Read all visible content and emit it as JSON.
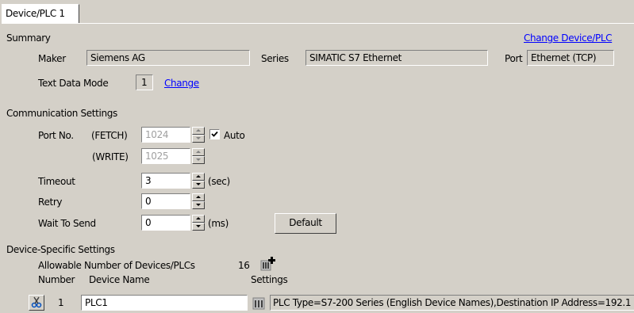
{
  "tab": {
    "label": "Device/PLC 1"
  },
  "summary": {
    "heading": "Summary",
    "change_link": "Change Device/PLC",
    "maker_label": "Maker",
    "maker_value": "Siemens AG",
    "series_label": "Series",
    "series_value": "SIMATIC S7 Ethernet",
    "port_label": "Port",
    "port_value": "Ethernet (TCP)",
    "text_mode_label": "Text Data Mode",
    "text_mode_value": "1",
    "text_mode_change": "Change"
  },
  "comm": {
    "heading": "Communication Settings",
    "port_label": "Port No.",
    "fetch_label": "(FETCH)",
    "fetch_value": "1024",
    "write_label": "(WRITE)",
    "write_value": "1025",
    "auto_label": "Auto",
    "auto_checked": true,
    "timeout_label": "Timeout",
    "timeout_value": "3",
    "timeout_unit": "(sec)",
    "retry_label": "Retry",
    "retry_value": "0",
    "wait_label": "Wait To Send",
    "wait_value": "0",
    "wait_unit": "(ms)",
    "default_button": "Default"
  },
  "device": {
    "heading": "Device-Specific Settings",
    "allowable_label": "Allowable Number of Devices/PLCs",
    "allowable_value": "16",
    "col_number": "Number",
    "col_name": "Device Name",
    "col_settings": "Settings",
    "rows": [
      {
        "number": "1",
        "name": "PLC1",
        "settings": "PLC Type=S7-200 Series (English Device Names),Destination IP Address=192.1"
      }
    ]
  }
}
